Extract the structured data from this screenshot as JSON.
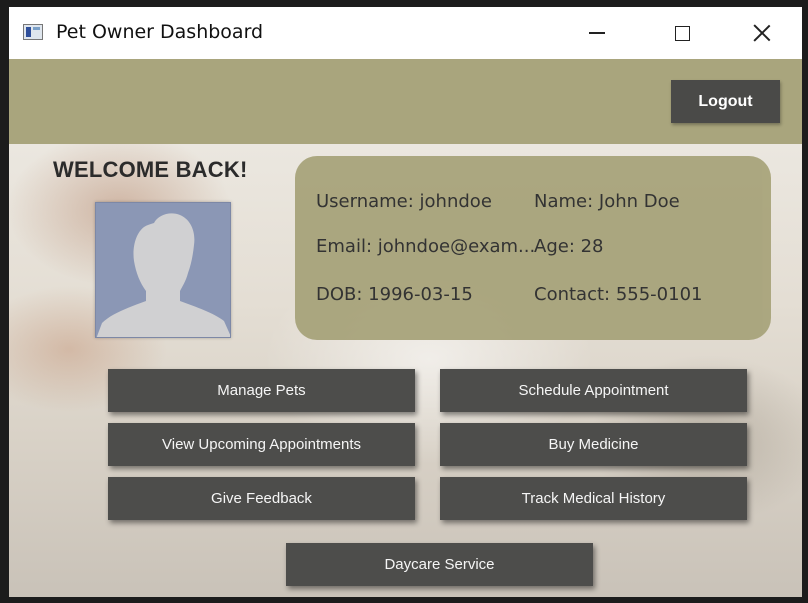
{
  "window": {
    "title": "Pet Owner Dashboard"
  },
  "header": {
    "logout_label": "Logout"
  },
  "welcome": "WELCOME BACK!",
  "profile": {
    "username": "Username: johndoe",
    "name": "Name: John Doe",
    "email": "Email: johndoe@exam...",
    "age": "Age: 28",
    "dob": "DOB: 1996-03-15",
    "contact": "Contact: 555-0101"
  },
  "actions": {
    "manage_pets": "Manage Pets",
    "schedule_appointment": "Schedule Appointment",
    "view_upcoming": "View Upcoming Appointments",
    "buy_medicine": "Buy Medicine",
    "give_feedback": "Give Feedback",
    "track_history": "Track Medical History",
    "daycare": "Daycare Service"
  },
  "colors": {
    "header_bar": "#a9a57d",
    "button": "#4d4d4b",
    "avatar_bg": "#8b97b5"
  },
  "icons": {
    "app": "app-window-icon",
    "avatar": "user-silhouette-icon"
  }
}
